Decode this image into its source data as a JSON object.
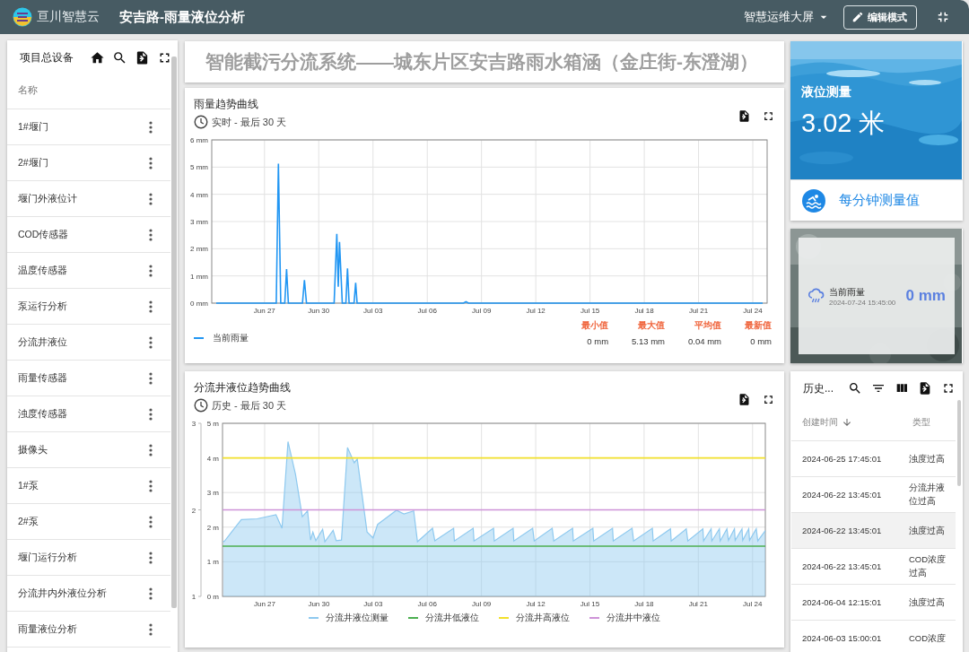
{
  "header": {
    "logo_text": "亘川智慧云",
    "title": "安吉路-雨量液位分析",
    "dashboard_menu": "智慧运维大屏",
    "edit_button": "编辑模式"
  },
  "sidebar": {
    "title": "项目总设备",
    "column": "名称",
    "items": [
      {
        "label": "1#堰门"
      },
      {
        "label": "2#堰门"
      },
      {
        "label": "堰门外液位计"
      },
      {
        "label": "COD传感器"
      },
      {
        "label": "温度传感器"
      },
      {
        "label": "泵运行分析"
      },
      {
        "label": "分流井液位"
      },
      {
        "label": "雨量传感器"
      },
      {
        "label": "浊度传感器"
      },
      {
        "label": "摄像头"
      },
      {
        "label": "1#泵"
      },
      {
        "label": "2#泵"
      },
      {
        "label": "堰门运行分析"
      },
      {
        "label": "分流井内外液位分析"
      },
      {
        "label": "雨量液位分析"
      }
    ]
  },
  "banner": {
    "title": "智能截污分流系统——城东片区安吉路雨水箱涵（金庄街-东澄湖）"
  },
  "rain_chart": {
    "title": "雨量趋势曲线",
    "subtitle": "实时 - 最后 30 天",
    "chart_data": {
      "type": "line",
      "grid": true,
      "x": [
        "2024-06-24T08:00",
        "2024-06-27T15:36",
        "2024-06-27T18:29",
        "2024-06-27T21:36",
        "2024-06-28T02:53",
        "2024-06-28T05:17",
        "2024-06-28T07:41",
        "2024-06-29T02:24",
        "2024-06-29T05:02",
        "2024-06-29T07:41",
        "2024-06-30T20:24",
        "2024-07-01T00:00",
        "2024-07-01T01:55",
        "2024-07-01T03:36",
        "2024-07-01T07:12",
        "2024-07-01T12:00",
        "2024-07-01T14:10",
        "2024-07-01T16:19",
        "2024-07-01T22:48",
        "2024-07-02T00:58",
        "2024-07-02T02:53",
        "2024-07-08T00:00",
        "2024-07-08T03:22",
        "2024-07-08T06:43",
        "2024-07-24T13:00"
      ],
      "series": [
        {
          "name": "当前雨量",
          "color": "#2196f3",
          "values": [
            0,
            0,
            5.13,
            0,
            0,
            1.25,
            0,
            0,
            0.85,
            0,
            0,
            2.55,
            0.6,
            2.25,
            0,
            0,
            1.28,
            0,
            0,
            0.75,
            0,
            0,
            0.05,
            0,
            0
          ]
        }
      ],
      "xlim": [
        "2024-06-24T02:00",
        "2024-07-24T19:00"
      ],
      "ylim": [
        0,
        6
      ],
      "xticks": [
        {
          "value": "2024-06-27",
          "label": "Jun 27"
        },
        {
          "value": "2024-06-30",
          "label": "Jun 30"
        },
        {
          "value": "2024-07-03",
          "label": "Jul 03"
        },
        {
          "value": "2024-07-06",
          "label": "Jul 06"
        },
        {
          "value": "2024-07-09",
          "label": "Jul 09"
        },
        {
          "value": "2024-07-12",
          "label": "Jul 12"
        },
        {
          "value": "2024-07-15",
          "label": "Jul 15"
        },
        {
          "value": "2024-07-18",
          "label": "Jul 18"
        },
        {
          "value": "2024-07-21",
          "label": "Jul 21"
        },
        {
          "value": "2024-07-24",
          "label": "Jul 24"
        }
      ],
      "yticks": [
        {
          "value": 0,
          "label": "0 mm"
        },
        {
          "value": 1,
          "label": "1 mm"
        },
        {
          "value": 2,
          "label": "2 mm"
        },
        {
          "value": 3,
          "label": "3 mm"
        },
        {
          "value": 4,
          "label": "4 mm"
        },
        {
          "value": 5,
          "label": "5 mm"
        },
        {
          "value": 6,
          "label": "6 mm"
        }
      ]
    },
    "stats": [
      {
        "label": "最小值",
        "value": "0 mm"
      },
      {
        "label": "最大值",
        "value": "5.13 mm"
      },
      {
        "label": "平均值",
        "value": "0.04 mm"
      },
      {
        "label": "最新值",
        "value": "0 mm"
      }
    ]
  },
  "level_chart": {
    "title": "分流井液位趋势曲线",
    "subtitle": "历史 - 最后 30 天",
    "secondary_axis_ticks": [
      "3",
      "2",
      "1"
    ],
    "chart_data": {
      "type": "area",
      "grid": true,
      "xlim": [
        "2024-06-24T16:00",
        "2024-07-24T17:00"
      ],
      "ylim": [
        0,
        5
      ],
      "xticks": [
        {
          "value": "2024-06-27",
          "label": "Jun 27"
        },
        {
          "value": "2024-06-30",
          "label": "Jun 30"
        },
        {
          "value": "2024-07-03",
          "label": "Jul 03"
        },
        {
          "value": "2024-07-06",
          "label": "Jul 06"
        },
        {
          "value": "2024-07-09",
          "label": "Jul 09"
        },
        {
          "value": "2024-07-12",
          "label": "Jul 12"
        },
        {
          "value": "2024-07-15",
          "label": "Jul 15"
        },
        {
          "value": "2024-07-18",
          "label": "Jul 18"
        },
        {
          "value": "2024-07-21",
          "label": "Jul 21"
        },
        {
          "value": "2024-07-24",
          "label": "Jul 24"
        }
      ],
      "yticks": [
        {
          "value": 0,
          "label": "0 m"
        },
        {
          "value": 1,
          "label": "1 m"
        },
        {
          "value": 2,
          "label": "2 m"
        },
        {
          "value": 3,
          "label": "3 m"
        },
        {
          "value": 4,
          "label": "4 m"
        },
        {
          "value": 5,
          "label": "5 m"
        }
      ],
      "series": [
        {
          "name": "分流井液位测量",
          "color": "#8ec9ef",
          "x": [
            "2024-06-24T17:00",
            "2024-06-24T18:00",
            "2024-06-25T12:00",
            "2024-06-25T17:00",
            "2024-06-26T14:00",
            "2024-06-27T15:00",
            "2024-06-27T23:00",
            "2024-06-28T07:00",
            "2024-06-28T17:00",
            "2024-06-29T02:00",
            "2024-06-29T09:00",
            "2024-06-29T13:00",
            "2024-06-29T16:00",
            "2024-06-29T20:00",
            "2024-06-30T05:00",
            "2024-06-30T08:00",
            "2024-06-30T19:00",
            "2024-06-30T23:00",
            "2024-07-01T06:00",
            "2024-07-01T14:00",
            "2024-07-01T23:00",
            "2024-07-02T03:00",
            "2024-07-02T16:00",
            "2024-07-03T00:00",
            "2024-07-03T06:00",
            "2024-07-04T07:00",
            "2024-07-04T17:00",
            "2024-07-05T06:00",
            "2024-07-05T11:00",
            "2024-07-06T07:00",
            "2024-07-06T10:00",
            "2024-07-07T11:00",
            "2024-07-07T12:00",
            "2024-07-08T13:00",
            "2024-07-08T14:00",
            "2024-07-09T16:00",
            "2024-07-09T17:00",
            "2024-07-10T18:00",
            "2024-07-10T19:00",
            "2024-07-11T20:00",
            "2024-07-11T22:00",
            "2024-07-12T22:00",
            "2024-07-13T00:00",
            "2024-07-14T01:00",
            "2024-07-14T02:00",
            "2024-07-15T04:00",
            "2024-07-15T05:00",
            "2024-07-16T06:00",
            "2024-07-16T07:00",
            "2024-07-17T08:00",
            "2024-07-17T10:00",
            "2024-07-18T11:00",
            "2024-07-18T12:00",
            "2024-07-19T11:00",
            "2024-07-19T12:00",
            "2024-07-20T08:00",
            "2024-07-20T10:00",
            "2024-07-21T06:00",
            "2024-07-21T07:00",
            "2024-07-21T17:00",
            "2024-07-21T18:00",
            "2024-07-22T04:00",
            "2024-07-22T05:00",
            "2024-07-22T14:00",
            "2024-07-22T16:00",
            "2024-07-23T00:00",
            "2024-07-23T01:00",
            "2024-07-23T10:00",
            "2024-07-23T11:00",
            "2024-07-23T19:00",
            "2024-07-23T20:00",
            "2024-07-24T05:00",
            "2024-07-24T07:00",
            "2024-07-24T17:00"
          ],
          "values": [
            1.6,
            1.58,
            2.08,
            2.22,
            2.24,
            2.36,
            1.97,
            4.47,
            3.52,
            2.3,
            2.47,
            1.63,
            1.86,
            1.61,
            1.94,
            1.58,
            1.91,
            1.61,
            1.63,
            4.3,
            3.86,
            3.97,
            1.86,
            1.69,
            2.08,
            2.49,
            2.38,
            2.47,
            1.58,
            1.97,
            1.61,
            1.97,
            1.6,
            1.97,
            1.6,
            1.97,
            1.6,
            1.97,
            1.6,
            1.97,
            1.6,
            1.97,
            1.6,
            1.97,
            1.6,
            1.97,
            1.6,
            1.97,
            1.6,
            1.97,
            1.6,
            1.97,
            1.6,
            1.95,
            1.6,
            1.95,
            1.6,
            1.95,
            1.6,
            1.95,
            1.6,
            1.95,
            1.6,
            1.95,
            1.62,
            1.95,
            1.62,
            1.95,
            1.62,
            1.95,
            1.62,
            1.95,
            1.6,
            1.9
          ]
        },
        {
          "name": "分流井低液位",
          "color": "#4caf50",
          "type": "line",
          "x": [
            "2024-06-24T16:00",
            "2024-07-24T17:00"
          ],
          "values": [
            1.45,
            1.45
          ]
        },
        {
          "name": "分流井高液位",
          "color": "#f2e02b",
          "type": "line",
          "x": [
            "2024-06-24T16:00",
            "2024-07-24T17:00"
          ],
          "values": [
            4.0,
            4.0
          ]
        },
        {
          "name": "分流井中液位",
          "color": "#ce93d8",
          "type": "line",
          "x": [
            "2024-06-24T16:00",
            "2024-07-24T17:00"
          ],
          "values": [
            2.5,
            2.5
          ]
        }
      ]
    }
  },
  "level_card": {
    "label": "液位测量",
    "value": "3.02 米",
    "footer": "每分钟测量值"
  },
  "rain_card": {
    "label": "当前雨量",
    "timestamp": "2024-07-24 15:45:00",
    "value": "0 mm"
  },
  "history": {
    "title": "历史...",
    "columns": [
      {
        "label": "创建时间",
        "sorted_descending": true
      },
      {
        "label": "类型"
      }
    ],
    "rows": [
      {
        "cells": [
          "2024-06-25 17:45:01",
          "浊度过高"
        ],
        "selected": false
      },
      {
        "cells": [
          "2024-06-22 13:45:01",
          "分流井液位过高"
        ],
        "selected": false
      },
      {
        "cells": [
          "2024-06-22 13:45:01",
          "浊度过高"
        ],
        "selected": true
      },
      {
        "cells": [
          "2024-06-22 13:45:01",
          "COD浓度过高"
        ],
        "selected": false
      },
      {
        "cells": [
          "2024-06-04 12:15:01",
          "浊度过高"
        ],
        "selected": false
      },
      {
        "cells": [
          "2024-06-03 15:00:01",
          "COD浓度"
        ],
        "selected": false
      }
    ]
  }
}
